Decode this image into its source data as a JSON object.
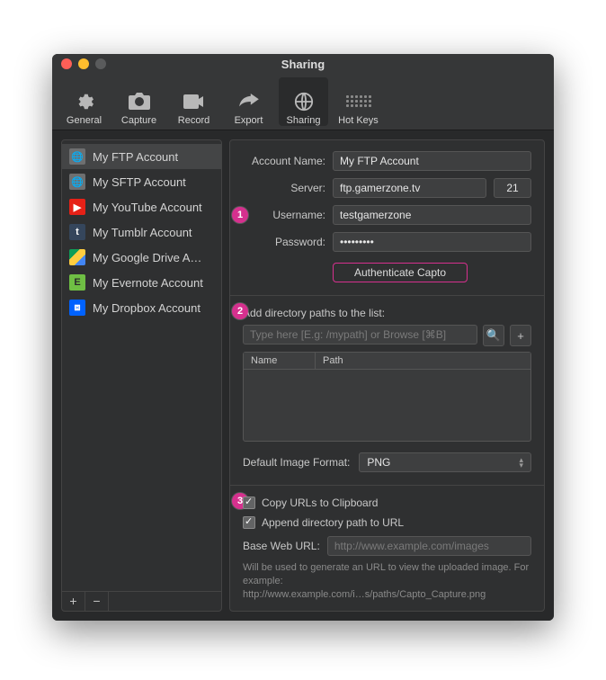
{
  "window": {
    "title": "Sharing"
  },
  "toolbar": {
    "items": [
      {
        "id": "general",
        "label": "General"
      },
      {
        "id": "capture",
        "label": "Capture"
      },
      {
        "id": "record",
        "label": "Record"
      },
      {
        "id": "export",
        "label": "Export"
      },
      {
        "id": "sharing",
        "label": "Sharing"
      },
      {
        "id": "hotkeys",
        "label": "Hot Keys"
      }
    ],
    "active": "sharing"
  },
  "sidebar": {
    "accounts": [
      {
        "icon": "globe-icon",
        "label": "My FTP Account",
        "selected": true
      },
      {
        "icon": "globe-icon",
        "label": "My SFTP Account",
        "selected": false
      },
      {
        "icon": "youtube-icon",
        "label": "My YouTube Account",
        "selected": false
      },
      {
        "icon": "tumblr-icon",
        "label": "My Tumblr Account",
        "selected": false
      },
      {
        "icon": "gdrive-icon",
        "label": "My Google Drive A…",
        "selected": false
      },
      {
        "icon": "evernote-icon",
        "label": "My Evernote Account",
        "selected": false
      },
      {
        "icon": "dropbox-icon",
        "label": "My Dropbox Account",
        "selected": false
      }
    ],
    "add_label": "+",
    "remove_label": "−"
  },
  "annotations": {
    "b1": "1",
    "b2": "2",
    "b3": "3"
  },
  "form": {
    "account_name_label": "Account Name:",
    "account_name_value": "My FTP Account",
    "server_label": "Server:",
    "server_value": "ftp.gamerzone.tv",
    "port_value": "21",
    "username_label": "Username:",
    "username_value": "testgamerzone",
    "password_label": "Password:",
    "password_value": "•••••••••",
    "auth_button": "Authenticate Capto"
  },
  "dirs": {
    "heading": "Add directory paths to the list:",
    "placeholder": "Type here [E.g: /mypath] or Browse [⌘B]",
    "col_name": "Name",
    "col_path": "Path",
    "format_label": "Default Image Format:",
    "format_value": "PNG"
  },
  "urls": {
    "copy_label": "Copy URLs to Clipboard",
    "append_label": "Append directory path to URL",
    "base_label": "Base Web URL:",
    "base_placeholder": "http://www.example.com/images",
    "help1": "Will be used to generate an URL to view the uploaded image. For example:",
    "help2": "http://www.example.com/i…s/paths/Capto_Capture.png"
  }
}
